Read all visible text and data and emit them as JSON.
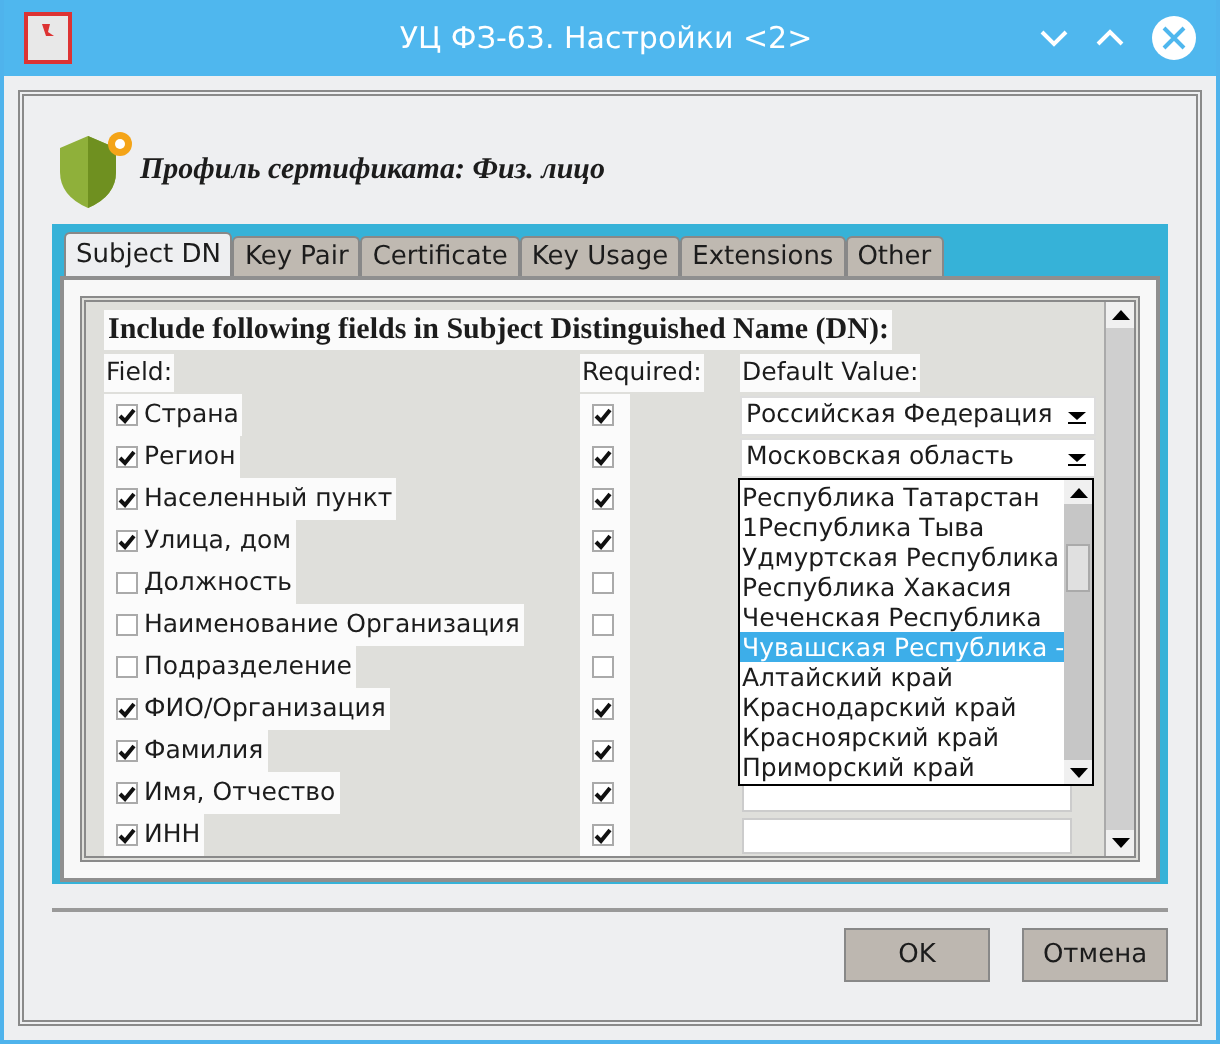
{
  "window": {
    "title": "УЦ ФЗ-63. Настройки <2>"
  },
  "header": {
    "title": "Профиль сертификата: Физ. лицо"
  },
  "tabs": [
    {
      "label": "Subject DN",
      "selected": true
    },
    {
      "label": "Key Pair",
      "selected": false
    },
    {
      "label": "Certificate",
      "selected": false
    },
    {
      "label": "Key Usage",
      "selected": false
    },
    {
      "label": "Extensions",
      "selected": false
    },
    {
      "label": "Other",
      "selected": false
    }
  ],
  "section": {
    "heading": "Include following fields in Subject Distinguished Name (DN):",
    "columns": [
      "Field:",
      "Required:",
      "Default Value:"
    ]
  },
  "fields": [
    {
      "label": "Страна",
      "included": true,
      "required": true,
      "default": {
        "kind": "combo",
        "value": "Российская Федерация"
      }
    },
    {
      "label": "Регион",
      "included": true,
      "required": true,
      "default": {
        "kind": "combo",
        "value": "Московская область"
      }
    },
    {
      "label": "Населенный пункт",
      "included": true,
      "required": true
    },
    {
      "label": "Улица, дом",
      "included": true,
      "required": true
    },
    {
      "label": "Должность",
      "included": false,
      "required": false
    },
    {
      "label": "Наименование Организация",
      "included": false,
      "required": false
    },
    {
      "label": "Подразделение",
      "included": false,
      "required": false
    },
    {
      "label": "ФИО/Организация",
      "included": true,
      "required": true
    },
    {
      "label": "Фамилия",
      "included": true,
      "required": true
    },
    {
      "label": "Имя, Отчество",
      "included": true,
      "required": true,
      "default": {
        "kind": "input"
      }
    },
    {
      "label": "ИНН",
      "included": true,
      "required": true,
      "default": {
        "kind": "input"
      }
    }
  ],
  "dropdown_list": [
    {
      "label": "Республика Татарстан",
      "selected": false
    },
    {
      "label": "1Республика Тыва",
      "selected": false
    },
    {
      "label": "Удмуртская Республика",
      "selected": false
    },
    {
      "label": "Республика Хакасия",
      "selected": false
    },
    {
      "label": "Чеченская Республика",
      "selected": false
    },
    {
      "label": "Чувашская Республика -",
      "selected": true
    },
    {
      "label": "Алтайский край",
      "selected": false
    },
    {
      "label": "Краснодарский край",
      "selected": false
    },
    {
      "label": "Красноярский край",
      "selected": false
    },
    {
      "label": "Приморский край",
      "selected": false
    }
  ],
  "buttons": [
    "OK",
    "Отмена"
  ]
}
